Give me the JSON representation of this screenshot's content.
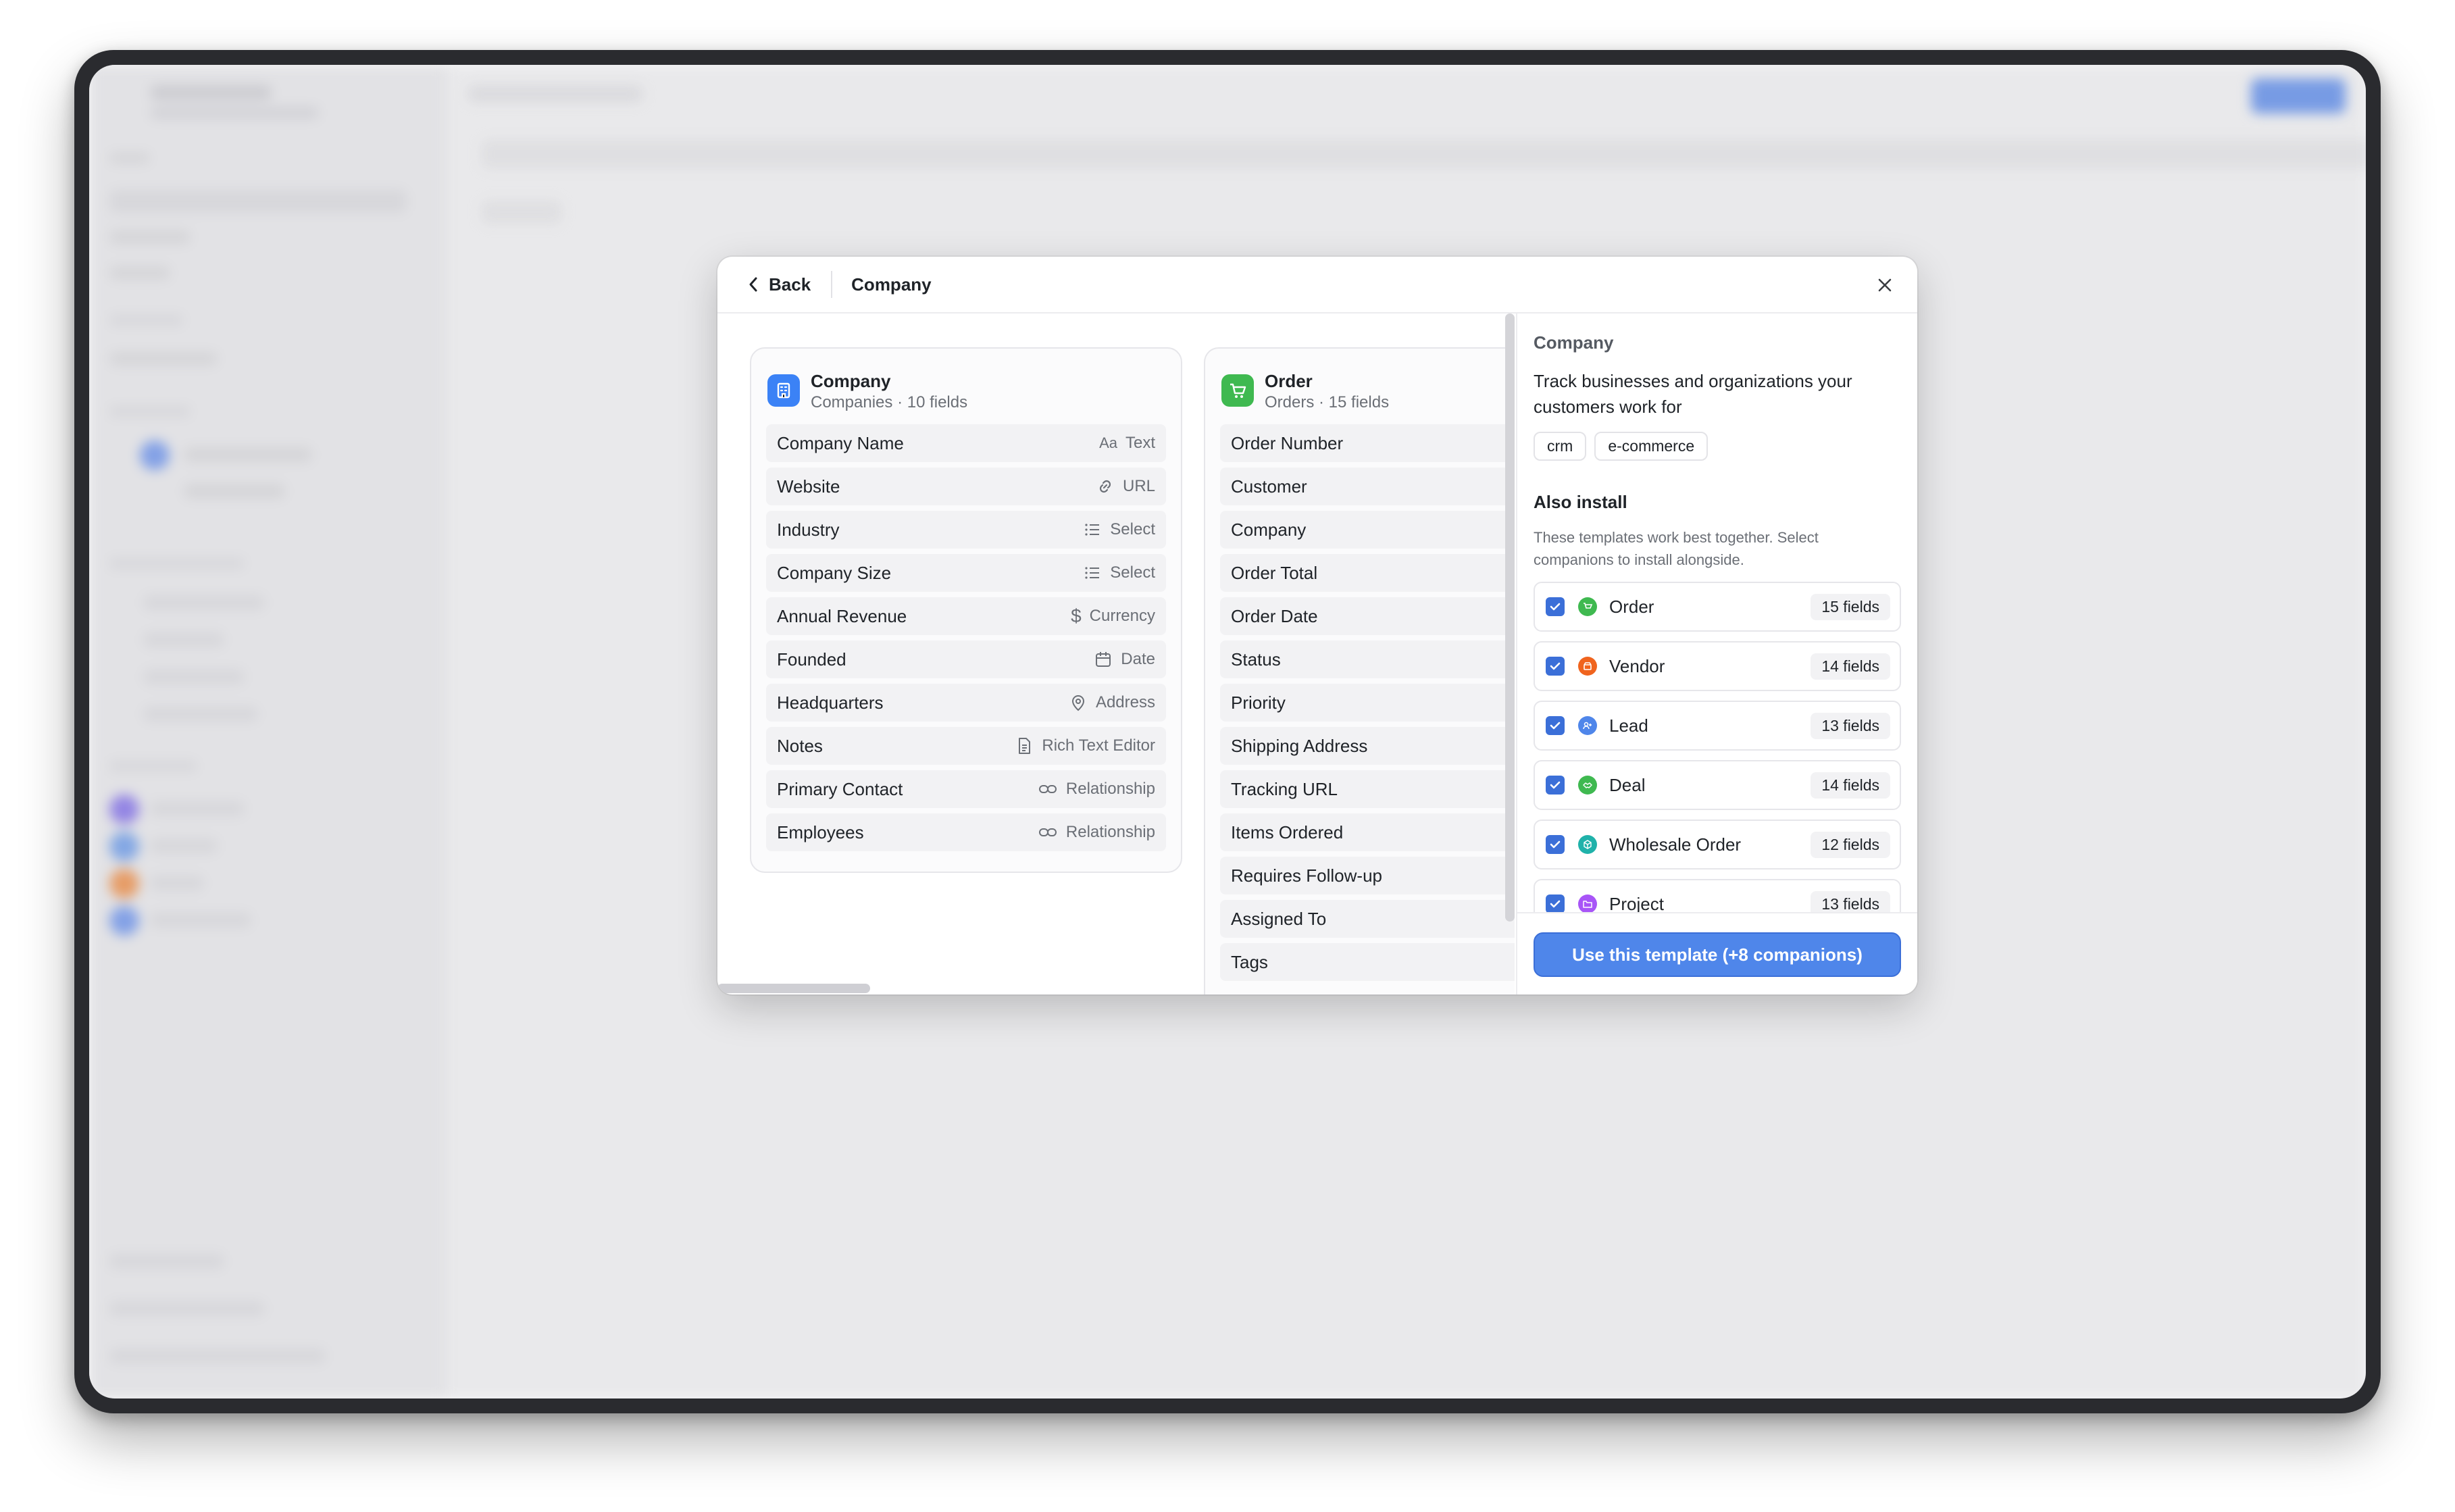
{
  "header": {
    "back_label": "Back",
    "title": "Company"
  },
  "card_company": {
    "title": "Company",
    "subtitle": "Companies · 10 fields",
    "fields": [
      {
        "name": "Company Name",
        "type": "Text",
        "icon": "text-type-icon"
      },
      {
        "name": "Website",
        "type": "URL",
        "icon": "link-icon"
      },
      {
        "name": "Industry",
        "type": "Select",
        "icon": "list-icon"
      },
      {
        "name": "Company Size",
        "type": "Select",
        "icon": "list-icon"
      },
      {
        "name": "Annual Revenue",
        "type": "Currency",
        "icon": "dollar-icon"
      },
      {
        "name": "Founded",
        "type": "Date",
        "icon": "calendar-icon"
      },
      {
        "name": "Headquarters",
        "type": "Address",
        "icon": "map-pin-icon"
      },
      {
        "name": "Notes",
        "type": "Rich Text Editor",
        "icon": "document-icon"
      },
      {
        "name": "Primary Contact",
        "type": "Relationship",
        "icon": "relationship-icon"
      },
      {
        "name": "Employees",
        "type": "Relationship",
        "icon": "relationship-icon"
      }
    ]
  },
  "card_order": {
    "title": "Order",
    "subtitle": "Orders · 15 fields",
    "fields": [
      {
        "name": "Order Number"
      },
      {
        "name": "Customer",
        "icon": "relationship-icon"
      },
      {
        "name": "Company",
        "icon": "relationship-icon"
      },
      {
        "name": "Order Total"
      },
      {
        "name": "Order Date",
        "icon": "calendar-clock-icon"
      },
      {
        "name": "Status"
      },
      {
        "name": "Priority"
      },
      {
        "name": "Shipping Address"
      },
      {
        "name": "Tracking URL"
      },
      {
        "name": "Items Ordered"
      },
      {
        "name": "Requires Follow-up"
      },
      {
        "name": "Assigned To"
      },
      {
        "name": "Tags"
      }
    ]
  },
  "panel": {
    "title": "Company",
    "description": "Track businesses and organizations your customers work for",
    "tags": [
      "crm",
      "e-commerce"
    ],
    "also_title": "Also install",
    "also_desc": "These templates work best together. Select companions to install alongside.",
    "companions": [
      {
        "name": "Order",
        "count": "15 fields",
        "color": "#3fb950",
        "icon": "cart-icon"
      },
      {
        "name": "Vendor",
        "count": "14 fields",
        "color": "#f0641e",
        "icon": "store-icon"
      },
      {
        "name": "Lead",
        "count": "13 fields",
        "color": "#4f86ea",
        "icon": "person-plus-icon"
      },
      {
        "name": "Deal",
        "count": "14 fields",
        "color": "#3fb950",
        "icon": "handshake-icon"
      },
      {
        "name": "Wholesale Order",
        "count": "12 fields",
        "color": "#20b2aa",
        "icon": "box-icon"
      },
      {
        "name": "Project",
        "count": "13 fields",
        "color": "#a855f7",
        "icon": "folder-icon"
      }
    ],
    "use_button": "Use this template (+8 companions)"
  },
  "colors": {
    "accent": "#4f86ea",
    "company_icon": "#3b82f6",
    "order_icon": "#3fb950"
  }
}
